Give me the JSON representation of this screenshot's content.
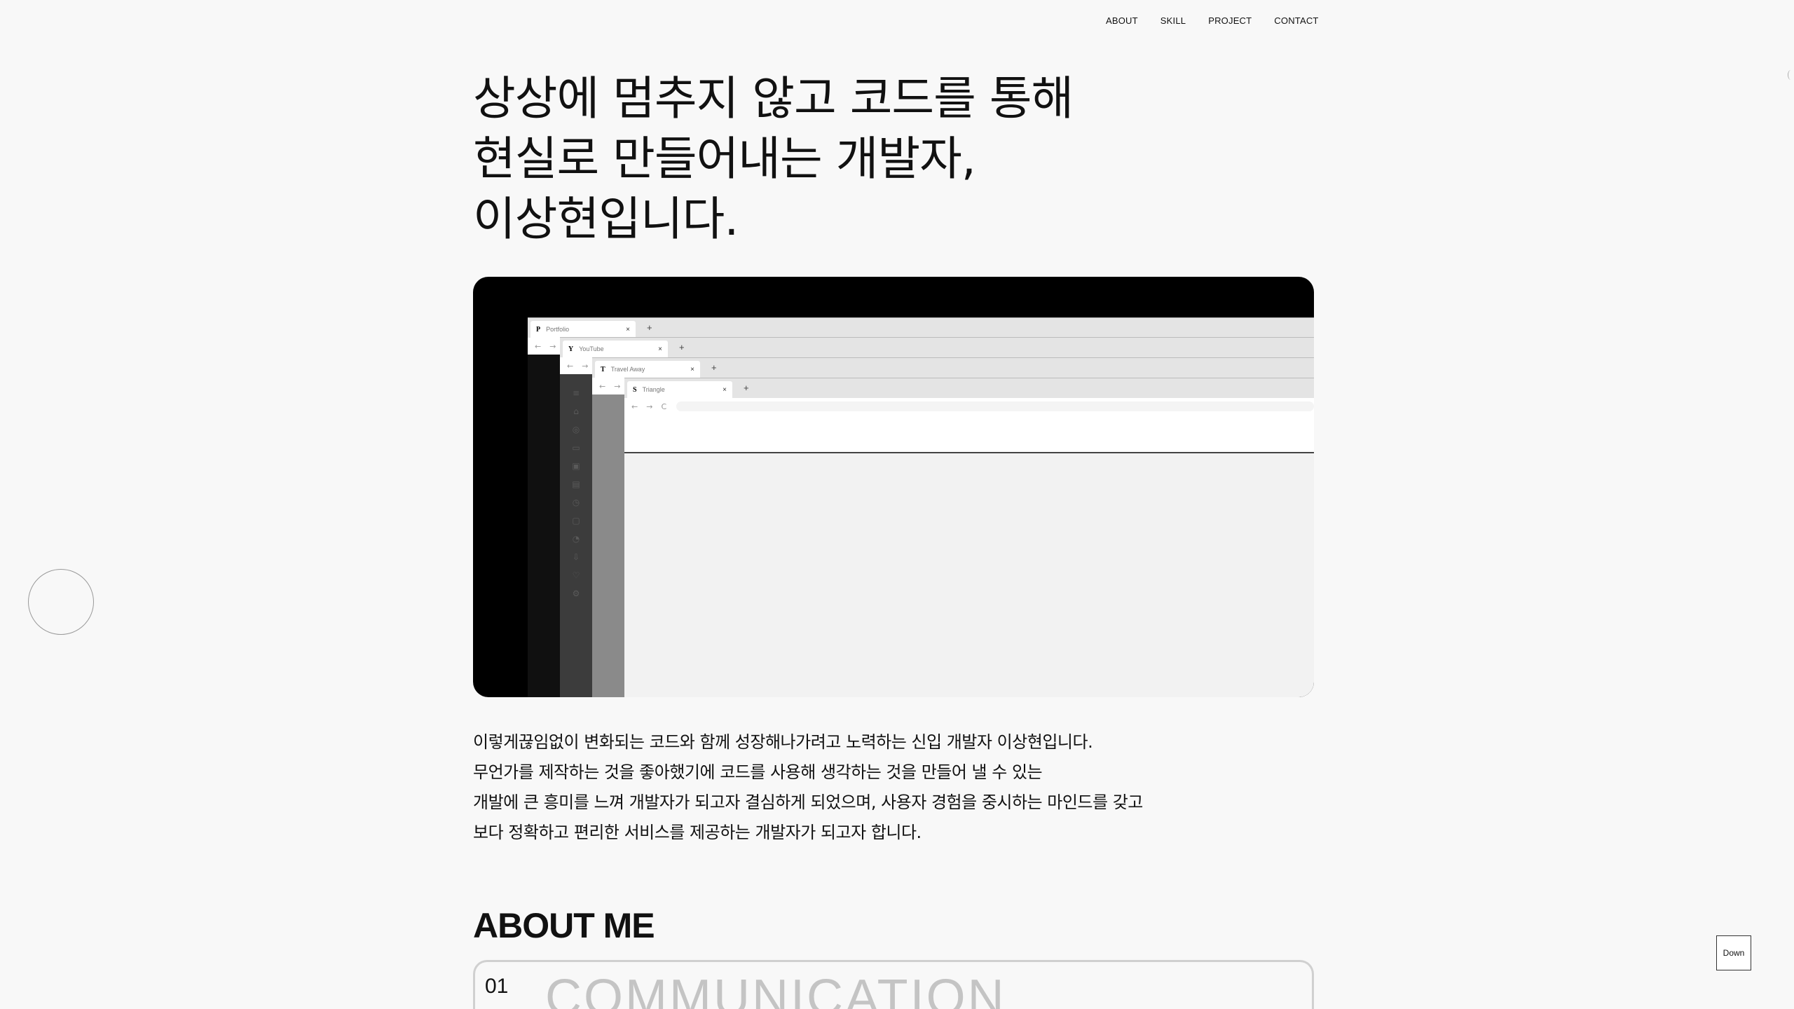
{
  "nav": [
    "ABOUT",
    "SKILL",
    "PROJECT",
    "CONTACT"
  ],
  "hero": {
    "lines": [
      "상상에 멈추지 않고 코드를 통해",
      "현실로 만들어내는 개발자,",
      "이상현입니다."
    ]
  },
  "browser": {
    "tabs": [
      {
        "fav": "P",
        "title": "Portfolio"
      },
      {
        "fav": "Y",
        "title": "YouTube"
      },
      {
        "fav": "T",
        "title": "Travel Away"
      },
      {
        "fav": "S",
        "title": "Triangle"
      }
    ],
    "close": "×",
    "plus": "+",
    "back": "←",
    "forward": "→",
    "reload": "C"
  },
  "description": [
    "이렇게끊임없이 변화되는 코드와 함께 성장해나가려고 노력하는 신입 개발자 이상현입니다.",
    "무언가를 제작하는 것을 좋아했기에 코드를 사용해 생각하는 것을 만들어 낼 수 있는",
    "개발에 큰 흥미를 느껴 개발자가 되고자 결심하게 되었으며, 사용자 경험을 중시하는 마인드를 갖고",
    "보다 정확하고 편리한 서비스를 제공하는 개발자가 되고자 합니다."
  ],
  "about": {
    "title": "ABOUT ME",
    "card_number": "01",
    "card_word": "COMMUNICATION"
  },
  "down_label": "Down"
}
